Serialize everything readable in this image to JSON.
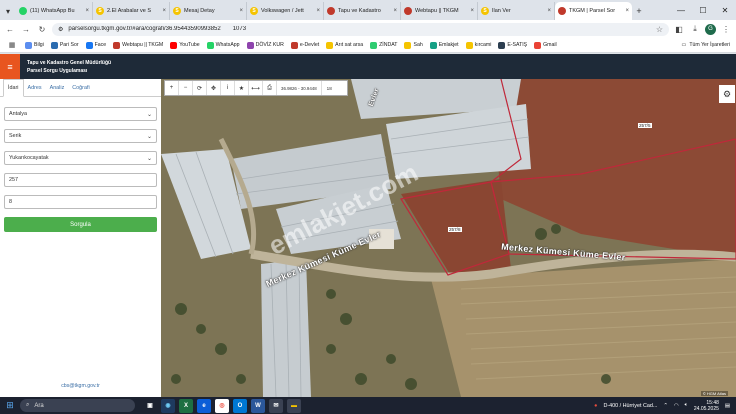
{
  "browser": {
    "tabs": [
      {
        "title": "(11) WhatsApp Bu",
        "icon": "whatsapp-icon",
        "color": "#25d366"
      },
      {
        "title": "2.El Arabalar ve S",
        "icon": "sahibinden-icon",
        "color": "#f5c400"
      },
      {
        "title": "Mesaj Detay",
        "icon": "sahibinden-icon",
        "color": "#f5c400"
      },
      {
        "title": "Volkswagen / Jett",
        "icon": "sahibinden-icon",
        "color": "#f5c400"
      },
      {
        "title": "Tapu ve Kadastro",
        "icon": "tkgm-icon",
        "color": "#c0392b"
      },
      {
        "title": "Webtapu || TKGM",
        "icon": "tkgm-icon",
        "color": "#c0392b"
      },
      {
        "title": "İlan Ver",
        "icon": "sahibinden-icon",
        "color": "#f5c400"
      },
      {
        "title": "TKGM | Parsel Sor",
        "icon": "tkgm-icon",
        "color": "#c0392b"
      }
    ],
    "url": "parselsorgu.tkgm.gov.tr/#ara/cografi/36.95443590993852",
    "url_tail": "1073",
    "profile_initial": "G",
    "bookmarks": [
      {
        "label": "Bilgi",
        "color": "#5b8def"
      },
      {
        "label": "Pari Sor",
        "color": "#2b6cb0"
      },
      {
        "label": "Face",
        "color": "#1877f2"
      },
      {
        "label": "Webtapu || TKGM",
        "color": "#c0392b"
      },
      {
        "label": "YouTube",
        "color": "#ff0000"
      },
      {
        "label": "WhatsApp",
        "color": "#25d366"
      },
      {
        "label": "DÖVİZ KUR",
        "color": "#8e44ad"
      },
      {
        "label": "e-Devlet",
        "color": "#c0392b"
      },
      {
        "label": "Arıt sat arsa",
        "color": "#f5c400"
      },
      {
        "label": "ZİNDAT",
        "color": "#2ecc71"
      },
      {
        "label": "Sah",
        "color": "#f5c400"
      },
      {
        "label": "Emlakjet",
        "color": "#16a085"
      },
      {
        "label": "kırcami",
        "color": "#f5c400"
      },
      {
        "label": "E-SATIŞ",
        "color": "#2c3e50"
      },
      {
        "label": "Gmail",
        "color": "#ea4335"
      }
    ],
    "all_bookmarks": "Tüm Yer İşaretleri"
  },
  "app": {
    "title_line1": "Tapu ve Kadastro Genel Müdürlüğü",
    "title_line2": "Parsel Sorgu Uygulaması",
    "accent": "#e8551f"
  },
  "panel": {
    "tabs": [
      "İdari",
      "Adres",
      "Analiz",
      "Coğrafi"
    ],
    "province": "Antalya",
    "district": "Serik",
    "neighborhood": "Yukarıkocayatak",
    "block": "257",
    "parcel": "8",
    "submit": "Sorgula",
    "email": "cbs@tkgm.gov.tr"
  },
  "map": {
    "coords": "36.9826 - 30.9448",
    "zoom": "18",
    "road_label_1": "Merkez Kümesi Küme Evler",
    "road_label_2": "Merkez Kümesi Küme Evler",
    "road_label_3": "Evler",
    "parcel_1": "257/8",
    "parcel_2": "257/5",
    "watermark": "emlakjet.com",
    "attribution": "© HGM Atlas"
  },
  "taskbar": {
    "search_placeholder": "Ara",
    "news": "D-400 / Hürriyet Cad...",
    "time": "15:48",
    "date": "24.05.2025"
  }
}
